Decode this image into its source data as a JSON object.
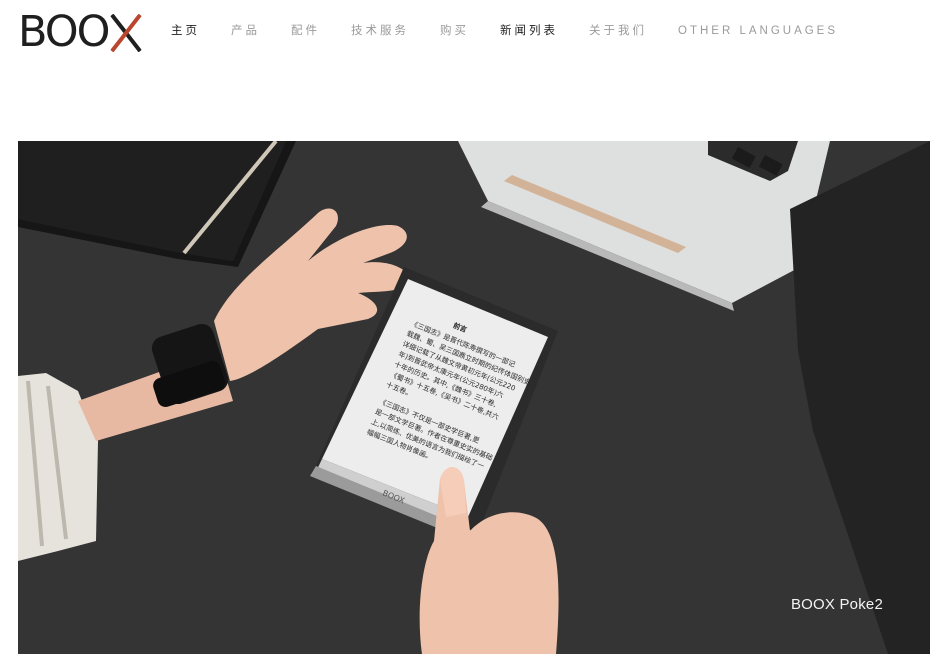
{
  "brand": {
    "logo_text": "BOO"
  },
  "nav": {
    "items": [
      {
        "label": "主页",
        "active": true
      },
      {
        "label": "产品",
        "active": false
      },
      {
        "label": "配件",
        "active": false
      },
      {
        "label": "技术服务",
        "active": false
      },
      {
        "label": "购买",
        "active": false
      },
      {
        "label": "新闻列表",
        "active": true
      },
      {
        "label": "关于我们",
        "active": false
      },
      {
        "label": "OTHER LANGUAGES",
        "active": false
      }
    ]
  },
  "hero": {
    "caption": "BOOX Poke2",
    "device_brand": "BOOX",
    "reader": {
      "heading": "前言",
      "lines": [
        "《三国志》是晋代陈寿撰写的一部记",
        "载魏、蜀、吴三国鼎立时期的纪传体国别史,",
        "详细记载了从魏文帝黄初元年(公元220",
        "年)到晋武帝太康元年(公元280年)六",
        "十年的历史。其中,《魏书》三十卷,",
        "《蜀书》十五卷,《吴书》二十卷,共六",
        "十五卷。",
        "《三国志》不仅是一部史学巨著,更",
        "是一部文学巨著。作者在尊重史实的基础",
        "上,以简练、优美的语言为我们描绘了一",
        "幅幅三国人物肖像画。"
      ]
    }
  },
  "colors": {
    "accent": "#b8472e",
    "text_dark": "#1e1e1e",
    "text_muted": "#9a9a9a"
  }
}
